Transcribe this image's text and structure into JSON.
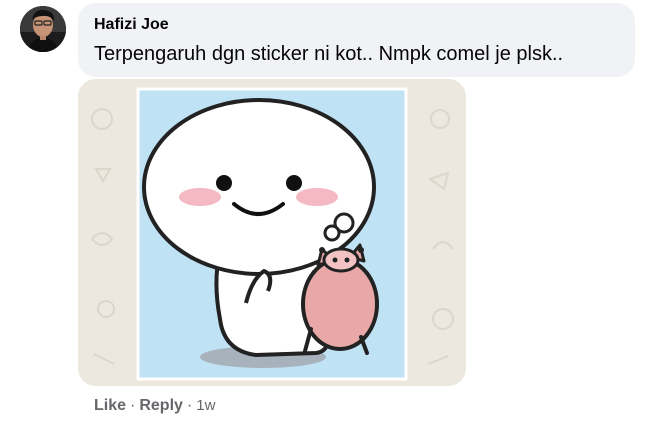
{
  "comment": {
    "author": "Hafizi Joe",
    "text": "Terpengaruh dgn sticker ni kot.. Nmpk comel je plsk.."
  },
  "actions": {
    "like_label": "Like",
    "separator": "·",
    "reply_label": "Reply",
    "timestamp": "1w"
  },
  "colors": {
    "bubble_background": "#f0f2f5",
    "meta_text": "#65676b",
    "sticker_background": "#bfe2f4",
    "pig": "#e8a8a8"
  },
  "attachment": {
    "type": "image",
    "icon": "cute-sticker-character-with-pig-image"
  }
}
